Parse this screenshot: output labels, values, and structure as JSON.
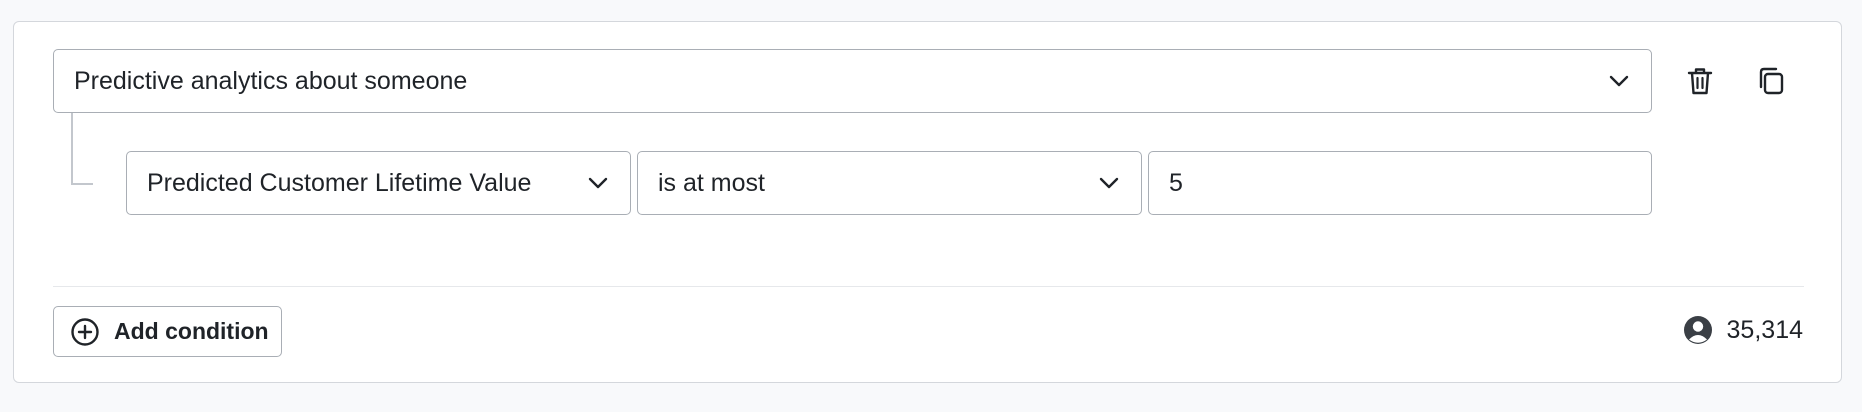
{
  "group": {
    "dimension_select": {
      "value": "Predictive analytics about someone"
    },
    "delete_icon": "trash-icon",
    "copy_icon": "copy-icon"
  },
  "condition": {
    "property_select": {
      "value": "Predicted Customer Lifetime Value"
    },
    "operator_select": {
      "value": "is at most"
    },
    "value_input": {
      "value": "5"
    }
  },
  "footer": {
    "add_condition_label": "Add condition",
    "count": "35,314"
  },
  "colors": {
    "border": "#a9aeb5",
    "text": "#1f2328",
    "background": "#f8f9fb"
  }
}
